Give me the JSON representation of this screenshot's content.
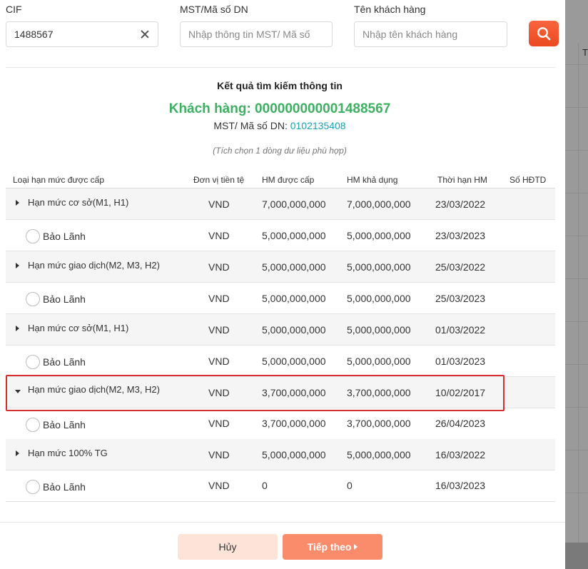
{
  "search": {
    "cif_label": "CIF",
    "cif_value": "1488567",
    "mst_label": "MST/Mã số DN",
    "mst_placeholder": "Nhập thông tin MST/ Mã số",
    "name_label": "Tên khách hàng",
    "name_placeholder": "Nhập tên khách hàng",
    "button_icon": "search-icon",
    "button_color": "#ef5126"
  },
  "result": {
    "title": "Kết quả tìm kiếm thông tin",
    "customer": "Khách hàng: 000000000001488567",
    "mst_label": "MST/ Mã số DN:",
    "mst_value": "0102135408",
    "hint": "(Tích chọn 1 dòng dư liệu phù hợp)",
    "customer_color": "#3eb062",
    "mst_color": "#17a2b8"
  },
  "table": {
    "headers": [
      "Loại hạn mức được cấp",
      "Đơn vị tiền tệ",
      "HM được cấp",
      "HM khả dụng",
      "Thời hạn HM",
      "Số HĐTD"
    ],
    "rows": [
      {
        "type": "group",
        "name": "Hạn mức cơ sở(M1, H1)",
        "currency": "VND",
        "granted": "7,000,000,000",
        "available": "7,000,000,000",
        "expiry": "23/03/2022",
        "expanded": false
      },
      {
        "type": "sub",
        "name": "Bảo Lãnh",
        "currency": "VND",
        "granted": "5,000,000,000",
        "available": "5,000,000,000",
        "expiry": "23/03/2023"
      },
      {
        "type": "group",
        "name": "Hạn mức giao dịch(M2, M3, H2)",
        "currency": "VND",
        "granted": "5,000,000,000",
        "available": "5,000,000,000",
        "expiry": "25/03/2022",
        "expanded": false
      },
      {
        "type": "sub",
        "name": "Bảo Lãnh",
        "currency": "VND",
        "granted": "5,000,000,000",
        "available": "5,000,000,000",
        "expiry": "25/03/2023"
      },
      {
        "type": "group",
        "name": "Hạn mức cơ sở(M1, H1)",
        "currency": "VND",
        "granted": "5,000,000,000",
        "available": "5,000,000,000",
        "expiry": "01/03/2022",
        "expanded": false
      },
      {
        "type": "sub",
        "name": "Bảo Lãnh",
        "currency": "VND",
        "granted": "5,000,000,000",
        "available": "5,000,000,000",
        "expiry": "01/03/2023"
      },
      {
        "type": "group",
        "name": "Hạn mức giao dịch(M2, M3, H2)",
        "currency": "VND",
        "granted": "3,700,000,000",
        "available": "3,700,000,000",
        "expiry": "10/02/2017",
        "expanded": true,
        "highlighted": true
      },
      {
        "type": "sub",
        "name": "Bảo Lãnh",
        "currency": "VND",
        "granted": "3,700,000,000",
        "available": "3,700,000,000",
        "expiry": "26/04/2023"
      },
      {
        "type": "group",
        "name": "Hạn mức 100% TG",
        "currency": "VND",
        "granted": "5,000,000,000",
        "available": "5,000,000,000",
        "expiry": "16/03/2022",
        "expanded": false
      },
      {
        "type": "sub",
        "name": "Bảo Lãnh",
        "currency": "VND",
        "granted": "0",
        "available": "0",
        "expiry": "16/03/2023"
      }
    ],
    "highlight_color": "#d32f2f"
  },
  "footer": {
    "cancel_label": "Hủy",
    "next_label": "Tiếp theo"
  },
  "background": {
    "header_fragment": "T"
  }
}
